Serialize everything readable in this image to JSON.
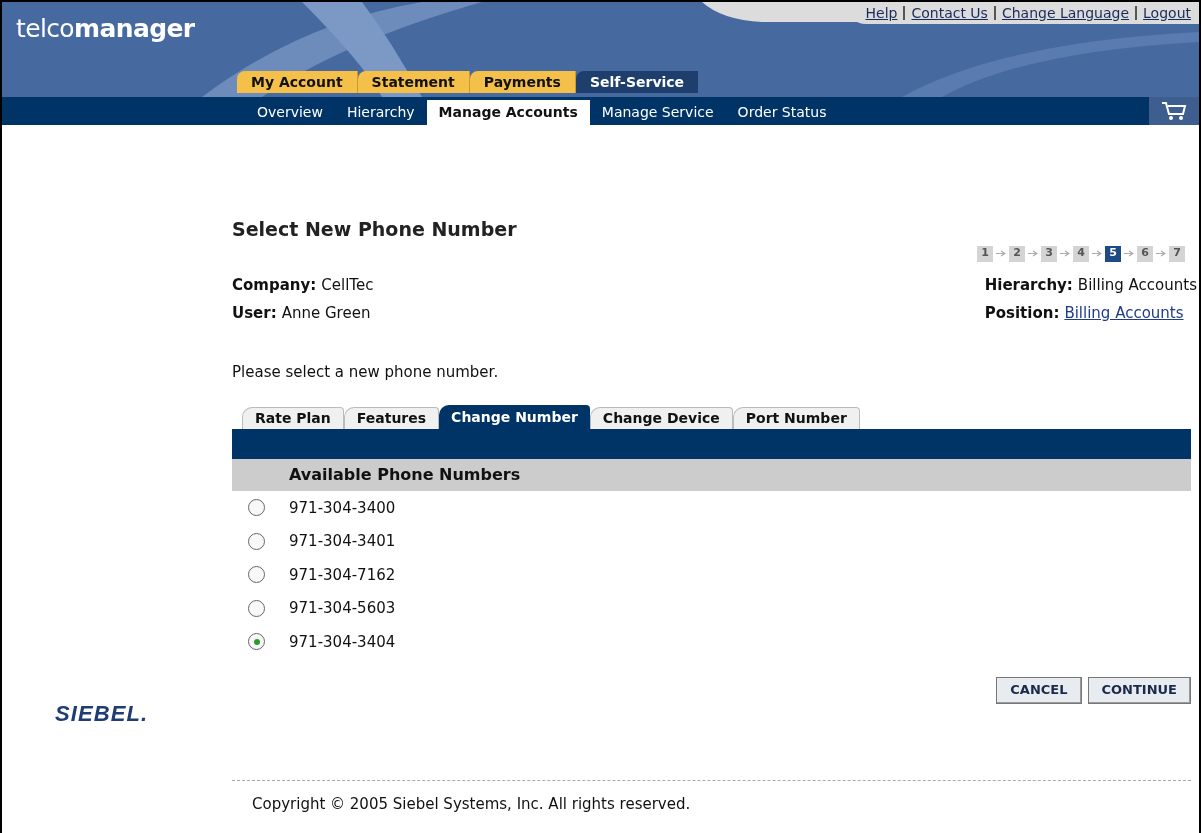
{
  "header": {
    "logo": "telco**manager**",
    "links": [
      "Help",
      "Contact Us",
      "Change Language",
      "Logout"
    ],
    "main_tabs": [
      {
        "label": "My Account",
        "selected": false
      },
      {
        "label": "Statement",
        "selected": false
      },
      {
        "label": "Payments",
        "selected": false
      },
      {
        "label": "Self-Service",
        "selected": true
      }
    ],
    "sub_tabs": [
      {
        "label": "Overview",
        "selected": false
      },
      {
        "label": "Hierarchy",
        "selected": false
      },
      {
        "label": "Manage Accounts",
        "selected": true
      },
      {
        "label": "Manage Service",
        "selected": false
      },
      {
        "label": "Order Status",
        "selected": false
      }
    ]
  },
  "page_title": "Select New Phone Number",
  "steps": [
    {
      "label": "1",
      "selected": false
    },
    {
      "label": "2",
      "selected": false
    },
    {
      "label": "3",
      "selected": false
    },
    {
      "label": "4",
      "selected": false
    },
    {
      "label": "5",
      "selected": true
    },
    {
      "label": "6",
      "selected": false
    },
    {
      "label": "7",
      "selected": false
    }
  ],
  "info_left": [
    {
      "label": "Company:",
      "value": "CellTec"
    },
    {
      "label": "User:",
      "value": "Anne Green"
    }
  ],
  "info_right": [
    {
      "label": "Hierarchy:",
      "value": "Billing Accounts",
      "kind": "text"
    },
    {
      "label": "Position:",
      "value": "Billing Accounts",
      "kind": "link"
    }
  ],
  "instruction": "Please select a new phone number.",
  "tabs": [
    {
      "label": "Rate Plan",
      "selected": false
    },
    {
      "label": "Features",
      "selected": false
    },
    {
      "label": "Change Number",
      "selected": true
    },
    {
      "label": "Change Device",
      "selected": false
    },
    {
      "label": "Port Number",
      "selected": false
    }
  ],
  "table": {
    "columns": [
      "Available Phone Numbers"
    ],
    "rows": [
      {
        "number": "971-304-3400",
        "selected": false
      },
      {
        "number": "971-304-3401",
        "selected": false
      },
      {
        "number": "971-304-7162",
        "selected": false
      },
      {
        "number": "971-304-5603",
        "selected": false
      },
      {
        "number": "971-304-3404",
        "selected": true
      }
    ]
  },
  "buttons": [
    "CANCEL",
    "CONTINUE"
  ],
  "brand_logo": "SIEBEL.",
  "footer": "Copyright © 2005 Siebel Systems, Inc. All rights reserved."
}
